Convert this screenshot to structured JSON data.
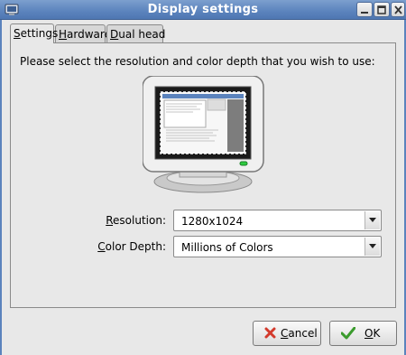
{
  "window": {
    "title": "Display settings",
    "buttons": [
      "minimize",
      "maximize",
      "close"
    ]
  },
  "tabs": [
    {
      "label_underlined": "S",
      "label_rest": "ettings",
      "selected": true
    },
    {
      "label_underlined": "H",
      "label_rest": "ardware",
      "selected": false
    },
    {
      "label_underlined": "D",
      "label_rest": "ual head",
      "selected": false
    }
  ],
  "settings": {
    "instructions": "Please select the resolution and color depth that you wish to use:",
    "resolution": {
      "label_underlined": "R",
      "label_rest": "esolution:",
      "value": "1280x1024"
    },
    "color_depth": {
      "label_underlined": "C",
      "label_rest": "olor Depth:",
      "value": "Millions of Colors"
    }
  },
  "actions": {
    "cancel": {
      "label_underlined": "C",
      "label_rest": "ancel"
    },
    "ok": {
      "label_underlined": "O",
      "label_rest": "K"
    }
  },
  "icons": {
    "cancel": "red-x-icon",
    "ok": "green-checkmark-icon"
  },
  "colors": {
    "titlebar": "#5b83bd",
    "cancel_icon": "#d33a2c",
    "ok_icon": "#3b9b2d",
    "power_led": "#2ecc40"
  }
}
